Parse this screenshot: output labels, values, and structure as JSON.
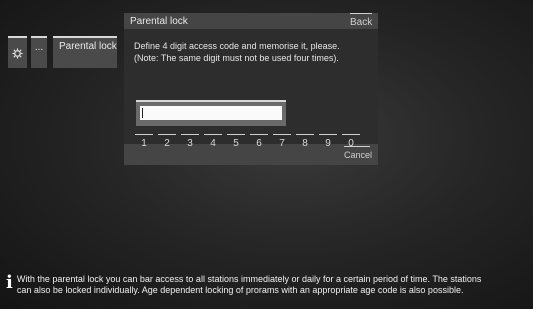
{
  "breadcrumb": {
    "gear_icon": "gear-icon",
    "dots_label": "...",
    "parental_label": "Parental lock"
  },
  "dialog": {
    "title": "Parental lock",
    "back_label": "Back",
    "message_line1": "Define 4 digit access code and memorise it, please.",
    "message_line2": "(Note: The same digit must not be used four times).",
    "code_value": "",
    "keys": [
      "1",
      "2",
      "3",
      "4",
      "5",
      "6",
      "7",
      "8",
      "9",
      "0"
    ],
    "cancel_label": "Cancel"
  },
  "info": {
    "icon": "info-icon",
    "text_line1": "With the parental lock you can bar access to all stations immediately or daily for a certain period of time. The stations",
    "text_line2": "can also be locked individually. Age dependent locking of prorams with an appropriate age code is also possible."
  }
}
